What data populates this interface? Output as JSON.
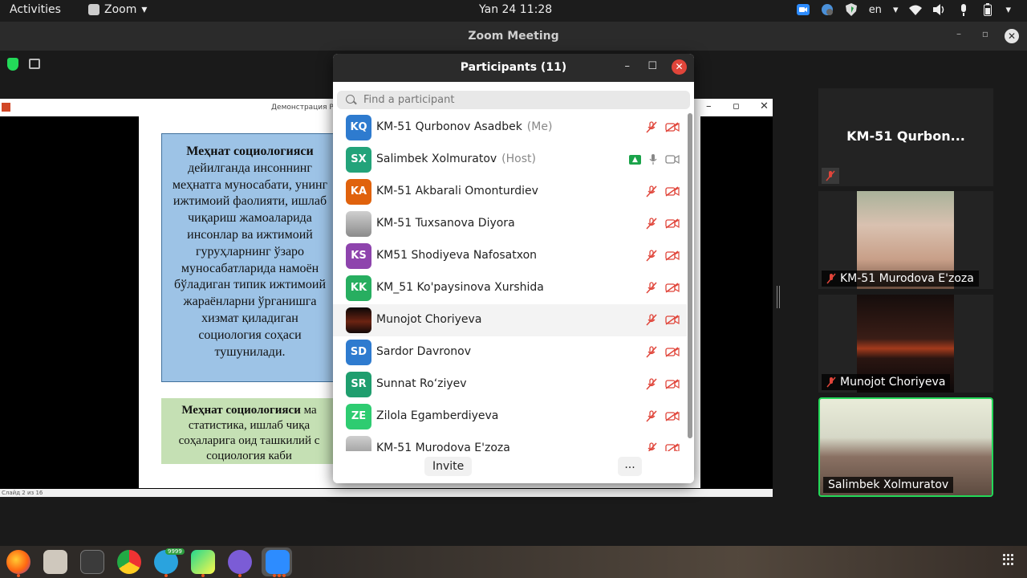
{
  "topbar": {
    "activities": "Activities",
    "app_name": "Zoom",
    "clock": "Yan 24  11:28",
    "lang": "en"
  },
  "window": {
    "title": "Zoom Meeting"
  },
  "presentation": {
    "title_bar": "Демонстрация Ро",
    "box1_bold": "Меҳнат социологияси",
    "box1_lines": [
      "дейилганда инсоннинг",
      "меҳнатга муносабати, унинг",
      "ижтимоий фаолияти, ишлаб",
      "чиқариш жамоаларида",
      "инсонлар ва ижтимоий",
      "гуруҳларнинг ўзаро",
      "муносабатларида намоён",
      "бўладиган типик ижтимоий",
      "жараёнларни ўрганишга",
      "хизмат қиладиган",
      "социология соҳаси",
      "тушунилади."
    ],
    "box2_bold": "Меҳнат социологияси",
    "box2_bold_tail": " ма",
    "box2_lines": [
      "статистика, ишлаб чиқа",
      "соҳаларига оид ташкилий с",
      "социология каби"
    ],
    "status": "Слайд 2 из 16"
  },
  "gallery": {
    "tile1_name": "KM-51 Qurbon...",
    "tile2_name": "KM-51 Murodova E'zoza",
    "tile3_name": "Munojot Choriyeva",
    "tile4_name": "Salimbek Xolmuratov"
  },
  "panel": {
    "title": "Participants (11)",
    "search_placeholder": "Find a participant",
    "invite": "Invite",
    "more": "...",
    "participants": [
      {
        "initials": "KQ",
        "name": "KM-51 Qurbonov Asadbek",
        "role": "(Me)",
        "color": "#2e7bcf"
      },
      {
        "initials": "SX",
        "name": "Salimbek Xolmuratov",
        "role": "(Host)",
        "color": "#23a37a"
      },
      {
        "initials": "KA",
        "name": "KM-51 Akbarali Omonturdiev",
        "role": "",
        "color": "#e0620d"
      },
      {
        "initials": "",
        "name": "KM-51 Tuxsanova Diyora",
        "role": "",
        "color": "#bbbbbb"
      },
      {
        "initials": "KS",
        "name": "KM51 Shodiyeva Nafosatxon",
        "role": "",
        "color": "#8e44ad"
      },
      {
        "initials": "KK",
        "name": "KM_51 Ko'paysinova Xurshida",
        "role": "",
        "color": "#27ae60"
      },
      {
        "initials": "",
        "name": "Munojot Choriyeva",
        "role": "",
        "color": "#222222"
      },
      {
        "initials": "SD",
        "name": "Sardor Davronov",
        "role": "",
        "color": "#2e7bcf"
      },
      {
        "initials": "SR",
        "name": "Sunnat Ro‘ziyev",
        "role": "",
        "color": "#1f9e6e"
      },
      {
        "initials": "ZE",
        "name": "Zilola Egamberdiyeva",
        "role": "",
        "color": "#2ecc71"
      },
      {
        "initials": "",
        "name": "KM-51 Murodova E'zoza",
        "role": "",
        "color": "#cccccc"
      }
    ]
  },
  "dock": {
    "telegram_badge": "9999"
  }
}
